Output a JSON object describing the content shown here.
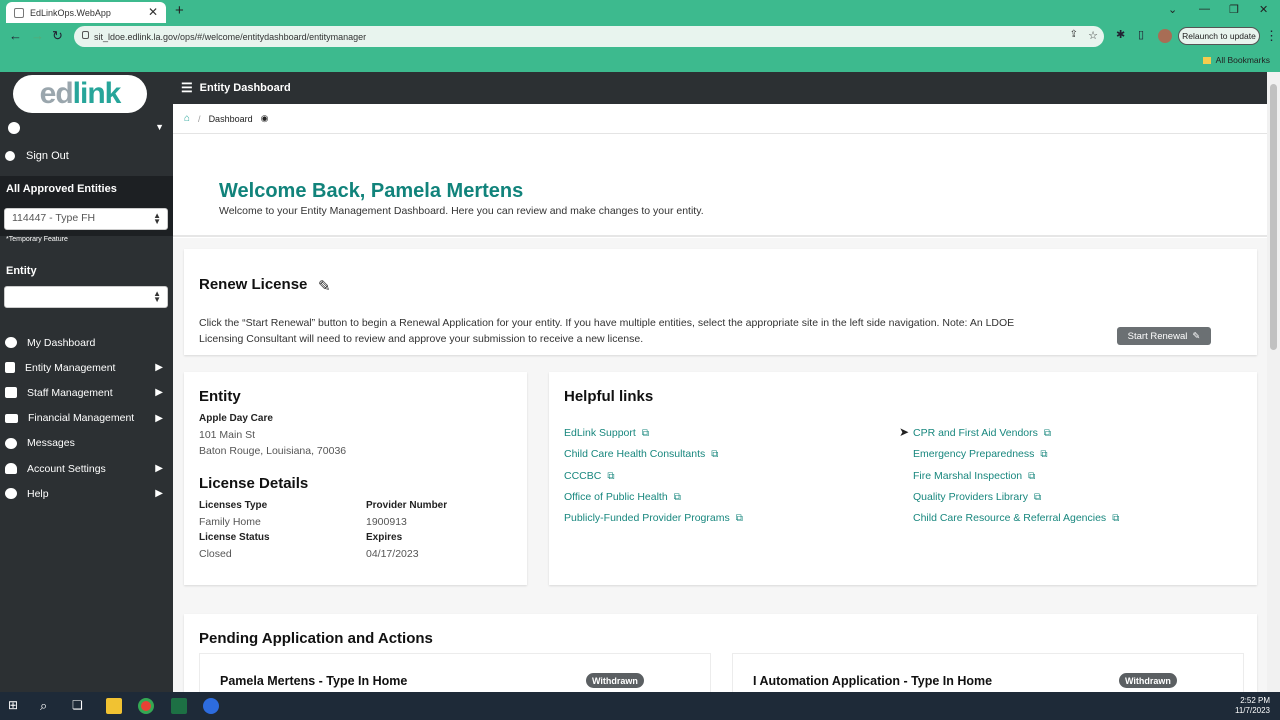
{
  "browser": {
    "tab_title": "EdLinkOps.WebApp",
    "url": "sit_ldoe.edlink.la.gov/ops/#/welcome/entitydashboard/entitymanager",
    "relaunch": "Relaunch to update",
    "bookmarks": "All Bookmarks"
  },
  "logo": {
    "text_a": "ed",
    "text_b": "link"
  },
  "sidebar": {
    "sign_out": "Sign Out",
    "approved_title": "All Approved Entities",
    "approved_value": "114447 - Type FH",
    "temp_note": "*Temporary Feature",
    "entity_title": "Entity",
    "entity_value": "",
    "menu": [
      {
        "label": "My Dashboard"
      },
      {
        "label": "Entity Management"
      },
      {
        "label": "Staff Management"
      },
      {
        "label": "Financial Management"
      },
      {
        "label": "Messages"
      },
      {
        "label": "Account Settings"
      },
      {
        "label": "Help"
      }
    ]
  },
  "header": {
    "title": "Entity Dashboard",
    "breadcrumb": "Dashboard"
  },
  "welcome": {
    "title": "Welcome Back, Pamela Mertens",
    "subtitle": "Welcome to your Entity Management Dashboard. Here you can review and make changes to your entity."
  },
  "renew": {
    "title": "Renew License",
    "text": "Click the “Start Renewal” button to begin a Renewal Application for your entity. If you have multiple entities, select the appropriate site in the left side navigation. Note: An LDOE Licensing Consultant will need to review and approve your submission to receive a new license.",
    "button": "Start Renewal"
  },
  "entity": {
    "title": "Entity",
    "name": "Apple Day Care",
    "address1": "101 Main St",
    "address2": "Baton Rouge, Louisiana, 70036",
    "license_title": "License Details",
    "licenses_type_label": "Licenses Type",
    "licenses_type_value": "Family Home",
    "provider_number_label": "Provider Number",
    "provider_number_value": "1900913",
    "license_status_label": "License Status",
    "license_status_value": "Closed",
    "expires_label": "Expires",
    "expires_value": "04/17/2023"
  },
  "helpful": {
    "title": "Helpful links",
    "left": [
      "EdLink Support",
      "Child Care Health Consultants",
      "CCCBC",
      "Office of Public Health",
      "Publicly-Funded Provider Programs"
    ],
    "right": [
      "CPR and First Aid Vendors",
      "Emergency Preparedness",
      "Fire Marshal Inspection",
      "Quality Providers Library",
      "Child Care Resource & Referral Agencies"
    ]
  },
  "pending": {
    "title": "Pending Application and Actions",
    "items": [
      {
        "title": "Pamela Mertens - Type In Home",
        "status": "Withdrawn"
      },
      {
        "title": "I Automation Application - Type In Home",
        "status": "Withdrawn"
      }
    ]
  },
  "taskbar": {
    "time": "2:52 PM",
    "date": "11/7/2023"
  },
  "colors": {
    "accent": "#11837b",
    "sidebar": "#2c3033",
    "chrome": "#3dba8e"
  }
}
